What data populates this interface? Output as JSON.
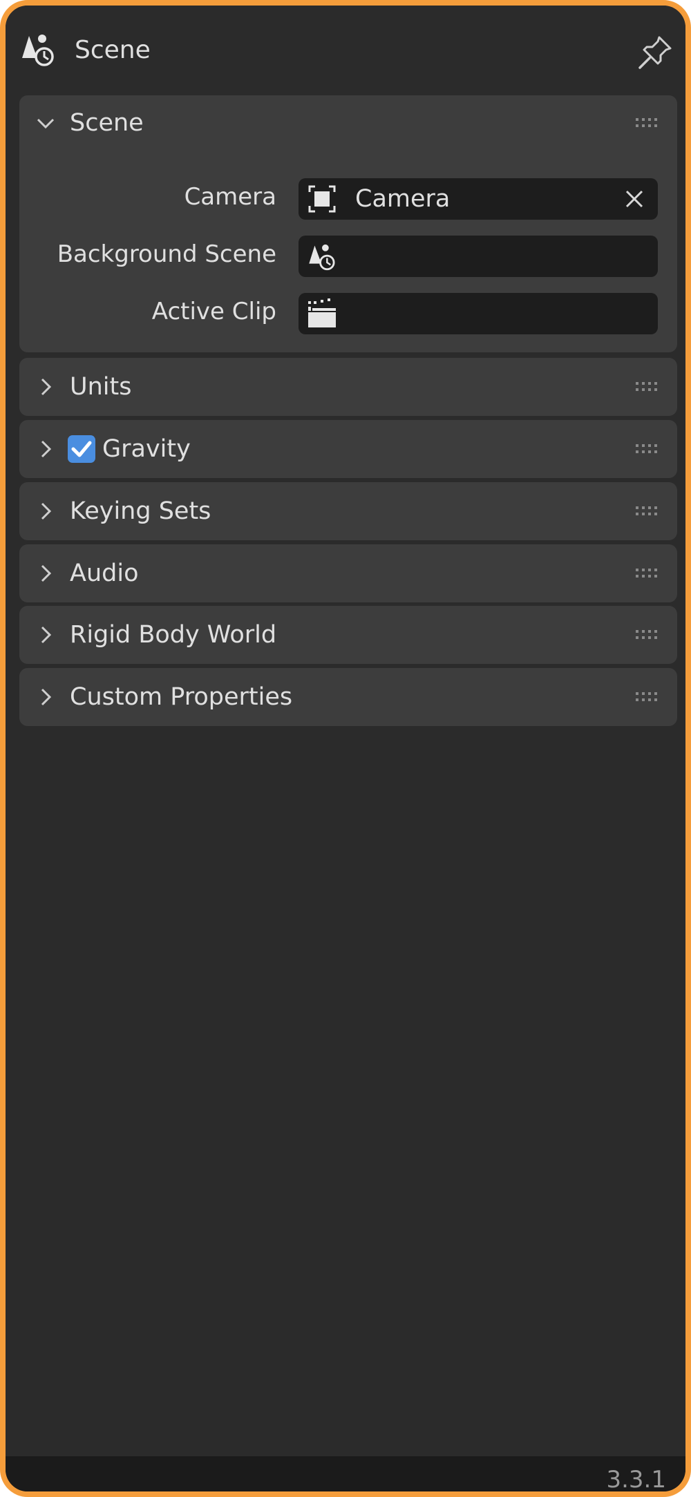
{
  "header": {
    "title": "Scene",
    "icon": "scene-icon",
    "pin_icon": "pin-icon"
  },
  "scene_panel": {
    "title": "Scene",
    "expanded": true,
    "properties": {
      "camera_label": "Camera",
      "camera_value": "Camera",
      "background_scene_label": "Background Scene",
      "background_scene_value": "",
      "active_clip_label": "Active Clip",
      "active_clip_value": ""
    }
  },
  "panels": {
    "units": "Units",
    "gravity": "Gravity",
    "keying_sets": "Keying Sets",
    "audio": "Audio",
    "rigid_body_world": "Rigid Body World",
    "custom_properties": "Custom Properties"
  },
  "gravity_enabled": true,
  "footer": {
    "version": "3.3.1"
  },
  "colors": {
    "accent_border": "#f59d3b",
    "checkbox": "#4a8ee0",
    "background": "#2b2b2b",
    "panel": "#3d3d3d",
    "field": "#1d1d1d"
  }
}
